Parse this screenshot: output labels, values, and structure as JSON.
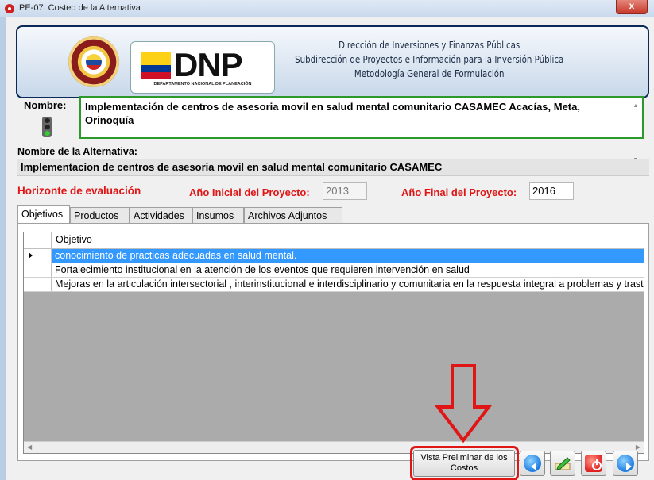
{
  "window": {
    "title": "PE-07: Costeo de la Alternativa",
    "close_label": "x"
  },
  "header": {
    "logo_text": "DNP",
    "logo_subtitle": "DEPARTAMENTO NACIONAL DE PLANEACIÓN",
    "line1": "Dirección de Inversiones y Finanzas Públicas",
    "line2": "Subdirección de Proyectos e Información para la Inversión Pública",
    "line3": "Metodología General de Formulación"
  },
  "project": {
    "name_label": "Nombre:",
    "name_value": "Implementación de centros de asesoria movil en salud mental comunitario CASAMEC Acacías, Meta, Orinoquía"
  },
  "alternative": {
    "label": "Nombre de la Alternativa:",
    "value": "Implementacion de centros de asesoria movil en salud mental comunitario CASAMEC"
  },
  "horizon": {
    "title": "Horizonte de evaluación",
    "start_label": "Año Inicial del Proyecto:",
    "start_value": "2013",
    "end_label": "Año Final del Proyecto:",
    "end_value": "2016"
  },
  "tabs": [
    {
      "label": "Objetivos",
      "active": true
    },
    {
      "label": "Productos",
      "active": false
    },
    {
      "label": "Actividades",
      "active": false
    },
    {
      "label": "Insumos",
      "active": false
    },
    {
      "label": "Archivos Adjuntos",
      "active": false
    }
  ],
  "grid": {
    "column_header": "Objetivo",
    "rows": [
      {
        "text": "conocimiento de practicas adecuadas en salud mental.",
        "selected": true
      },
      {
        "text": "Fortalecimiento  institucional en la atención  de  los eventos  que requieren intervención en salud",
        "selected": false
      },
      {
        "text": "Mejoras en  la articulación intersectorial , interinstitucional e interdisciplinario    y comunitaria en   la respuesta integral a  problemas y trastornos de salud mental",
        "selected": false
      }
    ]
  },
  "buttons": {
    "preview_label": "Vista Preliminar de los Costos",
    "back_icon": "arrow-left-icon",
    "edit_icon": "pencil-icon",
    "exit_icon": "power-icon",
    "next_icon": "arrow-right-icon"
  },
  "colors": {
    "accent_red": "#e01515",
    "name_border": "#2b9a2b",
    "selection": "#3399ff"
  }
}
